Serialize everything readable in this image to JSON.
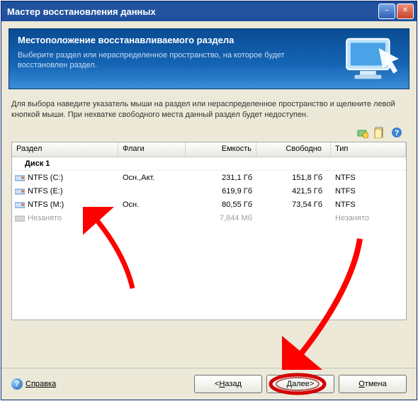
{
  "window": {
    "title": "Мастер восстановления данных"
  },
  "banner": {
    "heading": "Местоположение восстанавливаемого раздела",
    "text": "Выберите раздел или нераспределенное пространство, на которое будет восстановлен раздел."
  },
  "instruction": "Для выбора наведите указатель мыши на раздел или нераспределенное пространство и щелкните левой кнопкой мыши. При нехватке свободного места данный раздел будет недоступен.",
  "columns": {
    "partition": "Раздел",
    "flags": "Флаги",
    "capacity": "Емкость",
    "free": "Свободно",
    "type": "Тип"
  },
  "group": "Диск 1",
  "rows": [
    {
      "name": "NTFS (C:)",
      "flags": "Осн.,Акт.",
      "capacity": "231,1 Гб",
      "free": "151,8 Гб",
      "type": "NTFS",
      "icon": "disk",
      "dim": false
    },
    {
      "name": "NTFS (E:)",
      "flags": "",
      "capacity": "619,9 Гб",
      "free": "421,5 Гб",
      "type": "NTFS",
      "icon": "disk",
      "dim": false
    },
    {
      "name": "NTFS (M:)",
      "flags": "Осн.",
      "capacity": "80,55 Гб",
      "free": "73,54 Гб",
      "type": "NTFS",
      "icon": "disk",
      "dim": false
    },
    {
      "name": "Незанято",
      "flags": "",
      "capacity": "7,844 Мб",
      "free": "",
      "type": "Незанято",
      "icon": "unalloc",
      "dim": true
    }
  ],
  "buttons": {
    "help": "Справка",
    "back": "Назад",
    "next": "Далее",
    "cancel": "Отмена"
  }
}
